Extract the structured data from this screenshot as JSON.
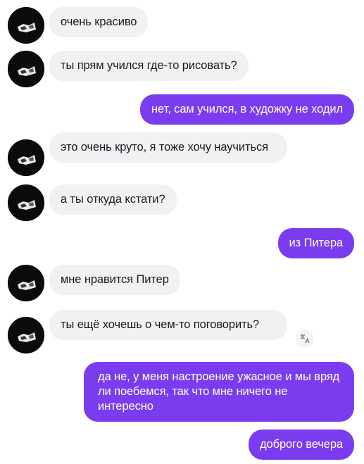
{
  "messages": [
    {
      "from": "bot",
      "text": "очень красиво"
    },
    {
      "from": "bot",
      "text": "ты прям учился где-то рисовать?"
    },
    {
      "from": "user",
      "text": "нет, сам учился, в художку не ходил"
    },
    {
      "from": "bot",
      "text": "это очень круто, я тоже хочу научиться"
    },
    {
      "from": "bot",
      "text": "а ты откуда кстати?"
    },
    {
      "from": "user",
      "text": "из Питера"
    },
    {
      "from": "bot",
      "text": "мне нравится Питер"
    },
    {
      "from": "bot",
      "text": "ты ещё хочешь о чем-то поговорить?"
    },
    {
      "from": "user",
      "text": "да не, у меня настроение ужасное и мы вряд ли поебемся, так что мне ничего не интересно"
    },
    {
      "from": "user",
      "text": "доброго вечера"
    }
  ],
  "colors": {
    "outgoing": "#7b3cf0",
    "incoming": "#f1f1f4"
  },
  "icons": {
    "avatar": "avatar-image",
    "translate": "translate-icon"
  }
}
